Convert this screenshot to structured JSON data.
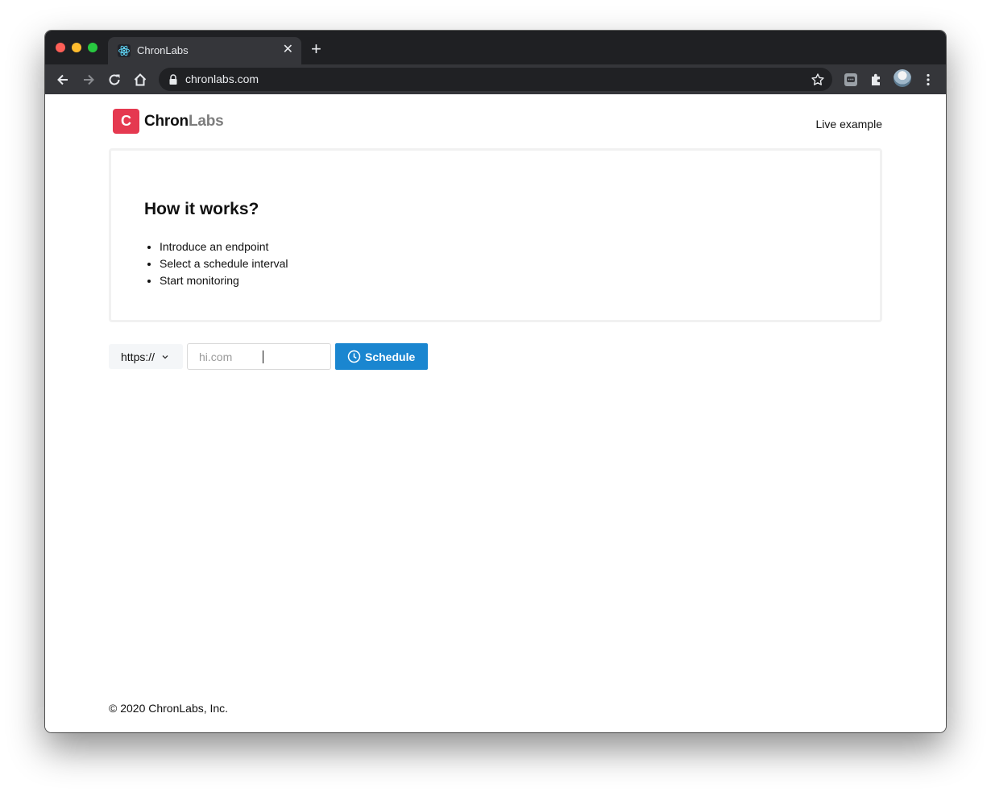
{
  "browser": {
    "tab_title": "ChronLabs",
    "tab_close": "✕",
    "new_tab": "+",
    "url": "chronlabs.com"
  },
  "header": {
    "logo_letter": "C",
    "logo_part1": "Chron",
    "logo_part2": "Labs",
    "live_example": "Live example"
  },
  "card": {
    "title": "How it works?",
    "steps": [
      "Introduce an endpoint",
      "Select a schedule interval",
      "Start monitoring"
    ]
  },
  "form": {
    "protocol": "https://",
    "host_placeholder": "hi.com",
    "host_value": "",
    "schedule_label": "Schedule"
  },
  "footer": {
    "copyright": "© 2020 ChronLabs, Inc."
  },
  "colors": {
    "brand": "#e53950",
    "primary_button": "#1a86d0"
  }
}
